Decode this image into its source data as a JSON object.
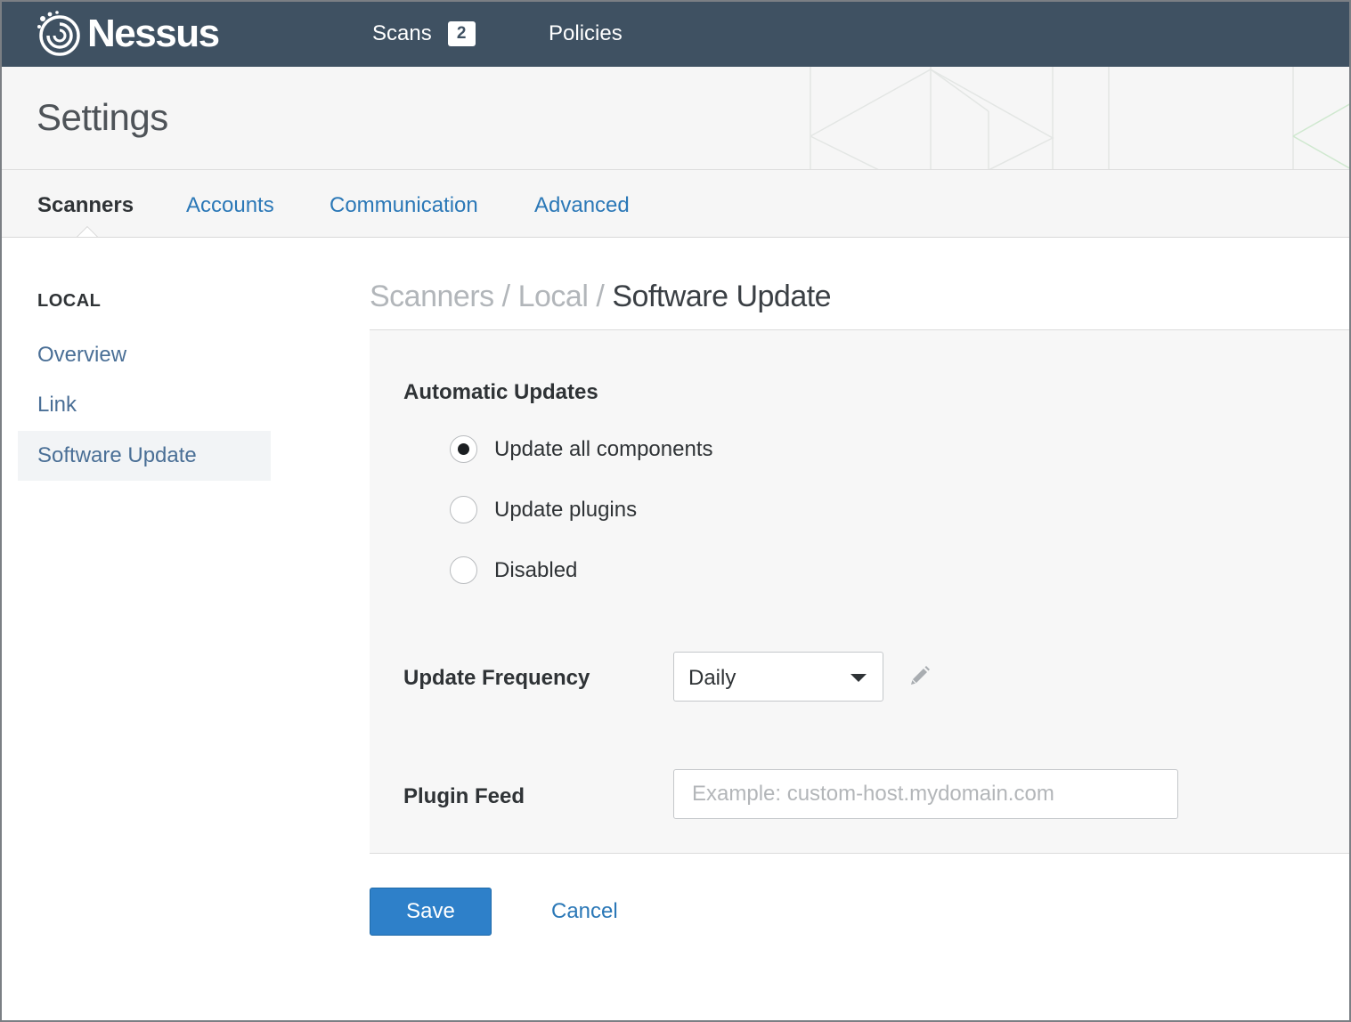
{
  "topbar": {
    "brand": "Nessus",
    "nav": [
      {
        "label": "Scans",
        "badge": "2"
      },
      {
        "label": "Policies"
      }
    ]
  },
  "header": {
    "title": "Settings"
  },
  "tabs": [
    {
      "label": "Scanners",
      "active": true
    },
    {
      "label": "Accounts"
    },
    {
      "label": "Communication"
    },
    {
      "label": "Advanced"
    }
  ],
  "sidebar": {
    "heading": "LOCAL",
    "items": [
      {
        "label": "Overview"
      },
      {
        "label": "Link"
      },
      {
        "label": "Software Update",
        "selected": true
      }
    ]
  },
  "breadcrumb": {
    "parts": [
      "Scanners",
      "Local",
      "Software Update"
    ],
    "separator": "/"
  },
  "form": {
    "automatic_updates": {
      "label": "Automatic Updates",
      "options": [
        {
          "label": "Update all components",
          "checked": true
        },
        {
          "label": "Update plugins",
          "checked": false
        },
        {
          "label": "Disabled",
          "checked": false
        }
      ]
    },
    "update_frequency": {
      "label": "Update Frequency",
      "value": "Daily"
    },
    "plugin_feed": {
      "label": "Plugin Feed",
      "value": "",
      "placeholder": "Example: custom-host.mydomain.com"
    }
  },
  "actions": {
    "save": "Save",
    "cancel": "Cancel"
  },
  "colors": {
    "topbar_bg": "#3f5162",
    "link": "#2b78b7",
    "primary_button": "#2e80c9",
    "panel_bg": "#f7f7f7"
  },
  "icons": {
    "logo": "nessus-logo-icon",
    "edit": "pencil-icon",
    "dropdown": "caret-down-icon"
  }
}
